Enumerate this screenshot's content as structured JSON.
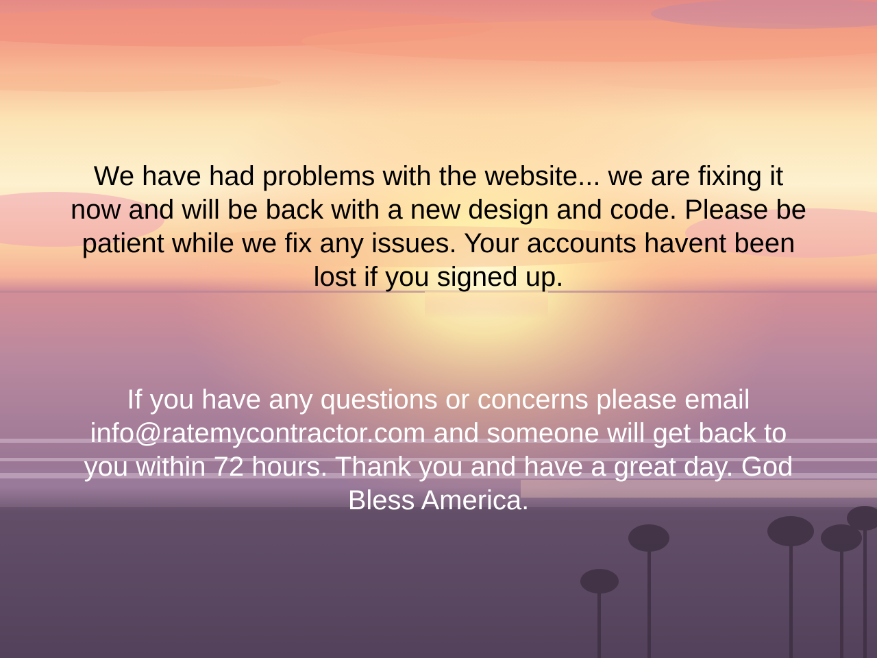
{
  "page": {
    "background_description_colors": {
      "sky_top": "#f4a08a",
      "sky_mid": "#fbe0a8",
      "sun_glow": "#fff6c8",
      "sea": "#9a6e90",
      "beach": "#5a4560"
    }
  },
  "notice": {
    "primary_text": "We have had problems with the website... we are fixing it now and will be back with a new design and code. Please be patient while we fix any issues. Your accounts havent been lost if you signed up.",
    "primary_color": "#000000"
  },
  "contact": {
    "secondary_text": "If you have any questions or concerns please email info@ratemycontractor.com and someone will get back to you within 72 hours. Thank you and have a great day. God Bless America.",
    "secondary_color": "#ffffff"
  }
}
